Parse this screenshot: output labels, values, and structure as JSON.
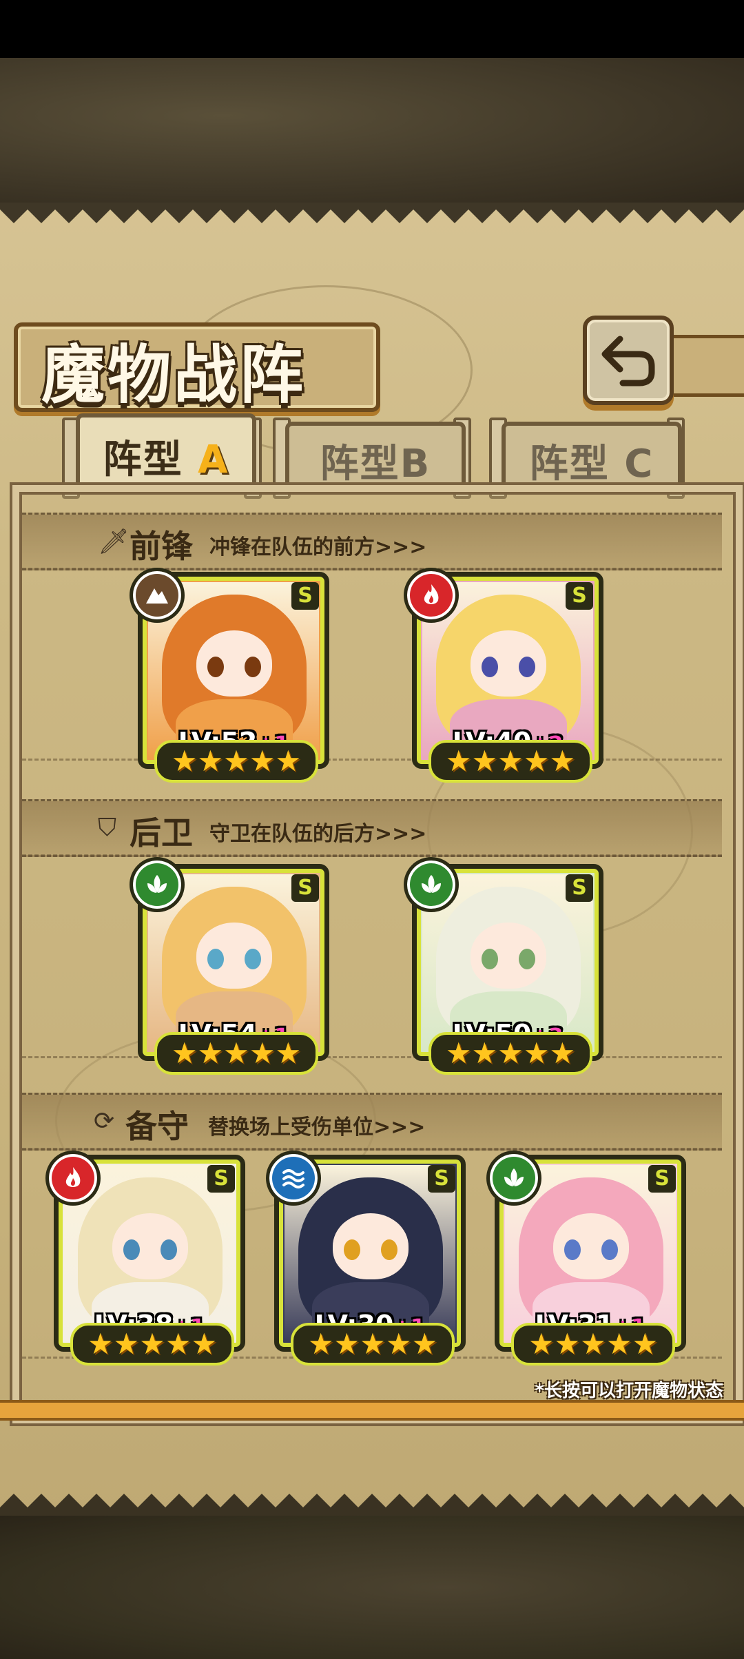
{
  "screen": {
    "title": "魔物战阵"
  },
  "tabs": [
    {
      "prefix": "阵型",
      "suffix": "A",
      "active": true
    },
    {
      "prefix": "阵型",
      "suffix": "B",
      "active": false
    },
    {
      "prefix": "阵型",
      "suffix": "C",
      "active": false
    }
  ],
  "sections": {
    "front": {
      "icon": "sword-icon",
      "title": "前锋",
      "desc": "冲锋在队伍的前方>>>"
    },
    "back": {
      "icon": "shield-icon",
      "title": "后卫",
      "desc": "守卫在队伍的后方>>>"
    },
    "reserve": {
      "icon": "swap-icon",
      "title": "备守",
      "desc": "替换场上受伤单位>>>"
    }
  },
  "cards": [
    {
      "element": "earth",
      "element_color": "#6b4a2c",
      "grade": "S",
      "level": "LV:52",
      "plus": "+1",
      "stars": "★★★★★",
      "hair": "#e07a2a",
      "eyes": "#7a3a10",
      "body": "#f0a04a"
    },
    {
      "element": "fire",
      "element_color": "#d8262a",
      "grade": "S",
      "level": "LV:40",
      "plus": "+2",
      "stars": "★★★★★",
      "hair": "#f6d56a",
      "eyes": "#4a4fa8",
      "body": "#e9a8c0"
    },
    {
      "element": "wind",
      "element_color": "#2f8a2f",
      "grade": "S",
      "level": "LV:54",
      "plus": "+1",
      "stars": "★★★★★",
      "hair": "#f2c26a",
      "eyes": "#5aa8c8",
      "body": "#e6b784"
    },
    {
      "element": "wind",
      "element_color": "#2f8a2f",
      "grade": "S",
      "level": "LV:50",
      "plus": "+3",
      "stars": "★★★★★",
      "hair": "#eeeede",
      "eyes": "#7aa86a",
      "body": "#d8e8c8"
    },
    {
      "element": "fire",
      "element_color": "#d8262a",
      "grade": "S",
      "level": "LV:38",
      "plus": "+1",
      "stars": "★★★★★",
      "hair": "#efe2b8",
      "eyes": "#4a8ab8",
      "body": "#f4efe4"
    },
    {
      "element": "water",
      "element_color": "#1e6fb8",
      "grade": "S",
      "level": "LV:30",
      "plus": "+1",
      "stars": "★★★★★",
      "hair": "#2a2f4a",
      "eyes": "#e0a020",
      "body": "#3a3d5a"
    },
    {
      "element": "wind",
      "element_color": "#2f8a2f",
      "grade": "S",
      "level": "LV:31",
      "plus": "+1",
      "stars": "★★★★★",
      "hair": "#f4a8bc",
      "eyes": "#5a7ac8",
      "body": "#f8d0dc"
    }
  ],
  "hint": "*长按可以打开魔物状态"
}
